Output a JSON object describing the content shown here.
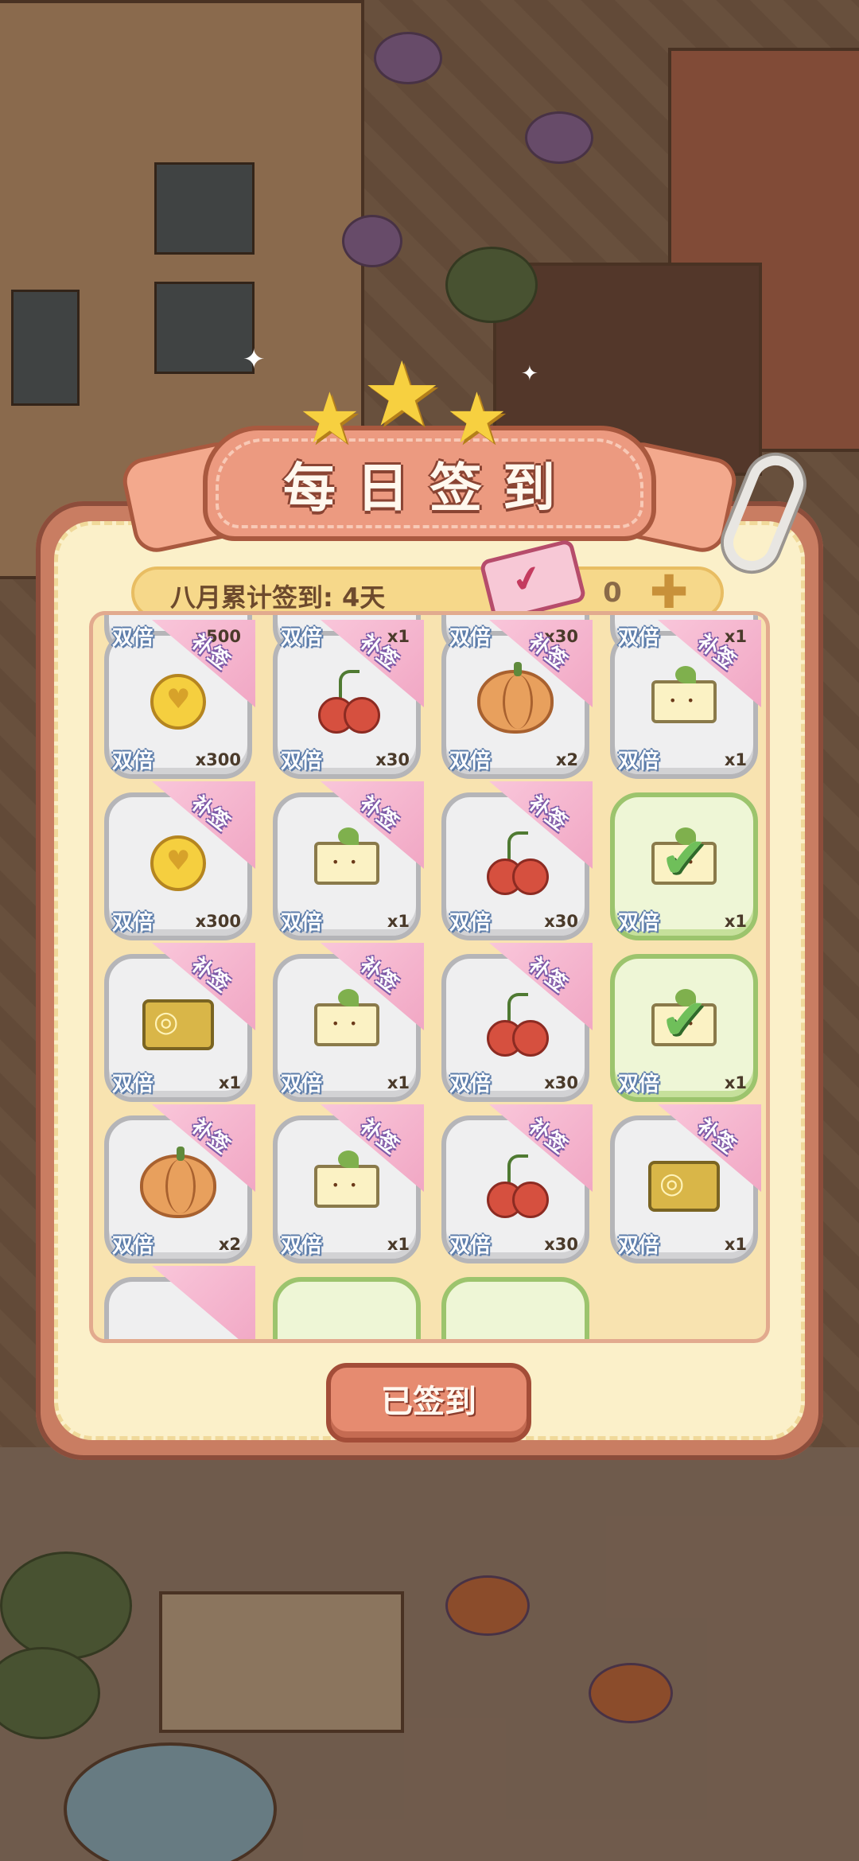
{
  "header": {
    "title": "每日签到"
  },
  "counter": {
    "label": "八月累计签到: 4天",
    "tickets": "0"
  },
  "grid": {
    "partial_top_row": [
      {
        "double": "双倍",
        "qty": "x500"
      },
      {
        "double": "双倍",
        "qty": "x1"
      },
      {
        "double": "双倍",
        "qty": "x30"
      },
      {
        "double": "双倍",
        "qty": "x1"
      }
    ],
    "rows": [
      [
        {
          "item": "coin",
          "double": "双倍",
          "qty": "x300",
          "flag": "补签",
          "signed": false
        },
        {
          "item": "cherry",
          "double": "双倍",
          "qty": "x30",
          "flag": "补签",
          "signed": false
        },
        {
          "item": "pumpkin",
          "double": "双倍",
          "qty": "x2",
          "flag": "补签",
          "signed": false
        },
        {
          "item": "sprout",
          "double": "双倍",
          "qty": "x1",
          "flag": "补签",
          "signed": false
        }
      ],
      [
        {
          "item": "coin",
          "double": "双倍",
          "qty": "x300",
          "flag": "补签",
          "signed": false
        },
        {
          "item": "sprout",
          "double": "双倍",
          "qty": "x1",
          "flag": "补签",
          "signed": false
        },
        {
          "item": "cherry",
          "double": "双倍",
          "qty": "x30",
          "flag": "补签",
          "signed": false
        },
        {
          "item": "crown-box",
          "double": "双倍",
          "qty": "x1",
          "flag": "",
          "signed": true
        }
      ],
      [
        {
          "item": "ticket",
          "double": "双倍",
          "qty": "x1",
          "flag": "补签",
          "signed": false
        },
        {
          "item": "sprout",
          "double": "双倍",
          "qty": "x1",
          "flag": "补签",
          "signed": false
        },
        {
          "item": "cherry",
          "double": "双倍",
          "qty": "x30",
          "flag": "补签",
          "signed": false
        },
        {
          "item": "crown-box",
          "double": "双倍",
          "qty": "x1",
          "flag": "",
          "signed": true
        }
      ],
      [
        {
          "item": "pumpkin",
          "double": "双倍",
          "qty": "x2",
          "flag": "补签",
          "signed": false
        },
        {
          "item": "sprout",
          "double": "双倍",
          "qty": "x1",
          "flag": "补签",
          "signed": false
        },
        {
          "item": "cherry",
          "double": "双倍",
          "qty": "x30",
          "flag": "补签",
          "signed": false
        },
        {
          "item": "ticket",
          "double": "双倍",
          "qty": "x1",
          "flag": "补签",
          "signed": false
        }
      ]
    ]
  },
  "button": {
    "label": "已签到"
  },
  "colors": {
    "accent": "#e68b70",
    "panel": "#fbf0c9",
    "flag": "#f1a7c4",
    "signed_border": "#9cc46d"
  }
}
